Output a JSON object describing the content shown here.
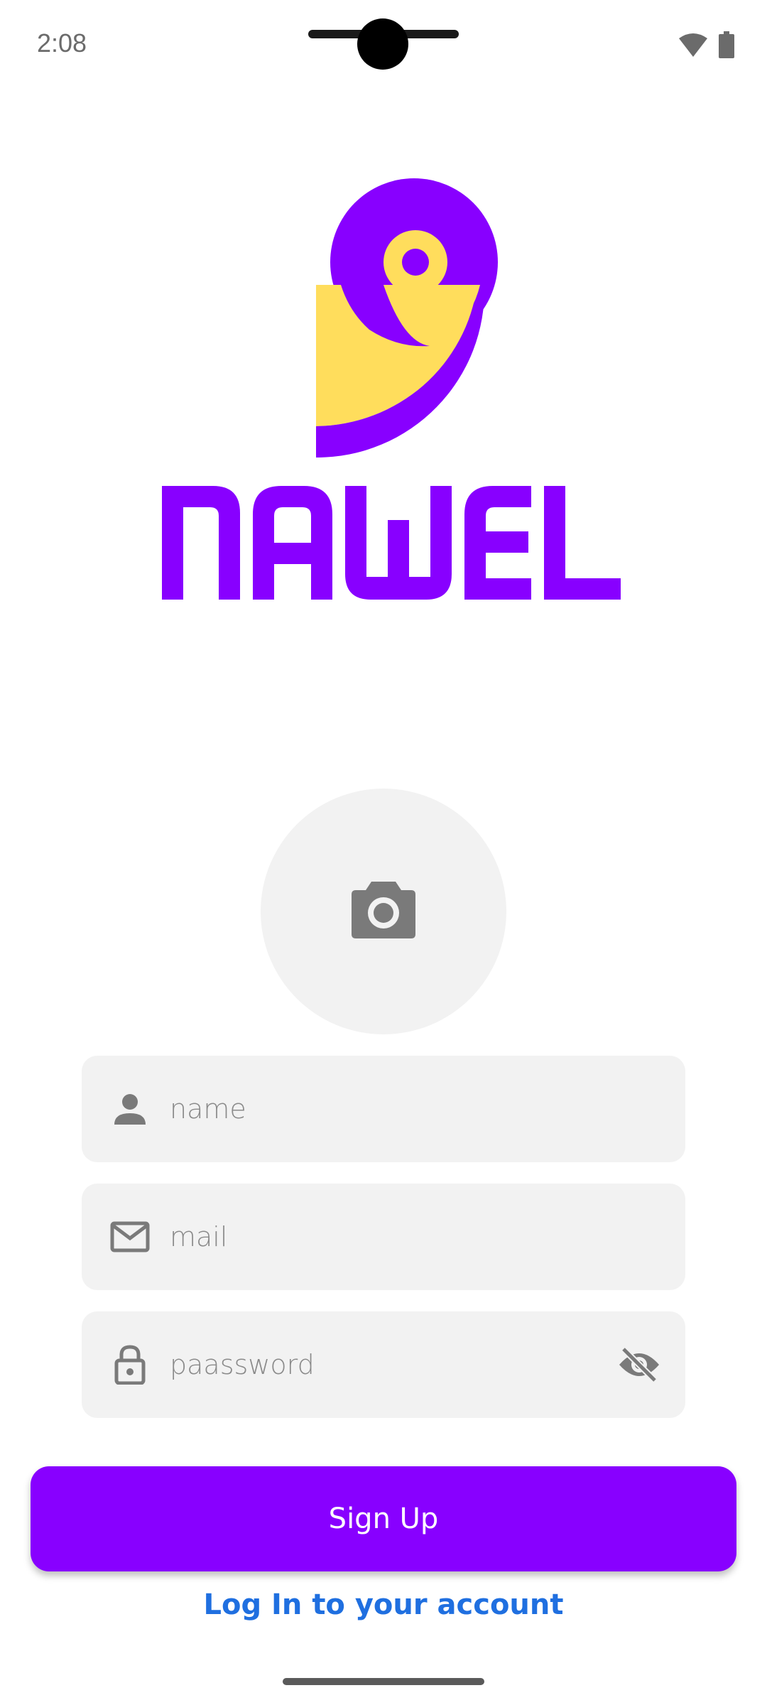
{
  "status_bar": {
    "time": "2:08",
    "icons": [
      "wifi-icon",
      "battery-icon"
    ]
  },
  "brand": {
    "logo_icon": "bird-logo-icon",
    "wordmark": "NAWEL",
    "primary_color": "#8800ff",
    "accent_color": "#ffdd5c"
  },
  "avatar": {
    "icon": "camera-icon"
  },
  "form": {
    "name": {
      "placeholder": "name",
      "value": "",
      "icon": "person-icon"
    },
    "mail": {
      "placeholder": "mail",
      "value": "",
      "icon": "mail-icon"
    },
    "password": {
      "placeholder": "paassword",
      "value": "",
      "icon": "lock-icon",
      "toggle_icon": "eye-off-icon"
    }
  },
  "actions": {
    "signup_label": "Sign Up",
    "login_label": "Log In to your account",
    "link_color": "#1f6fe0"
  }
}
